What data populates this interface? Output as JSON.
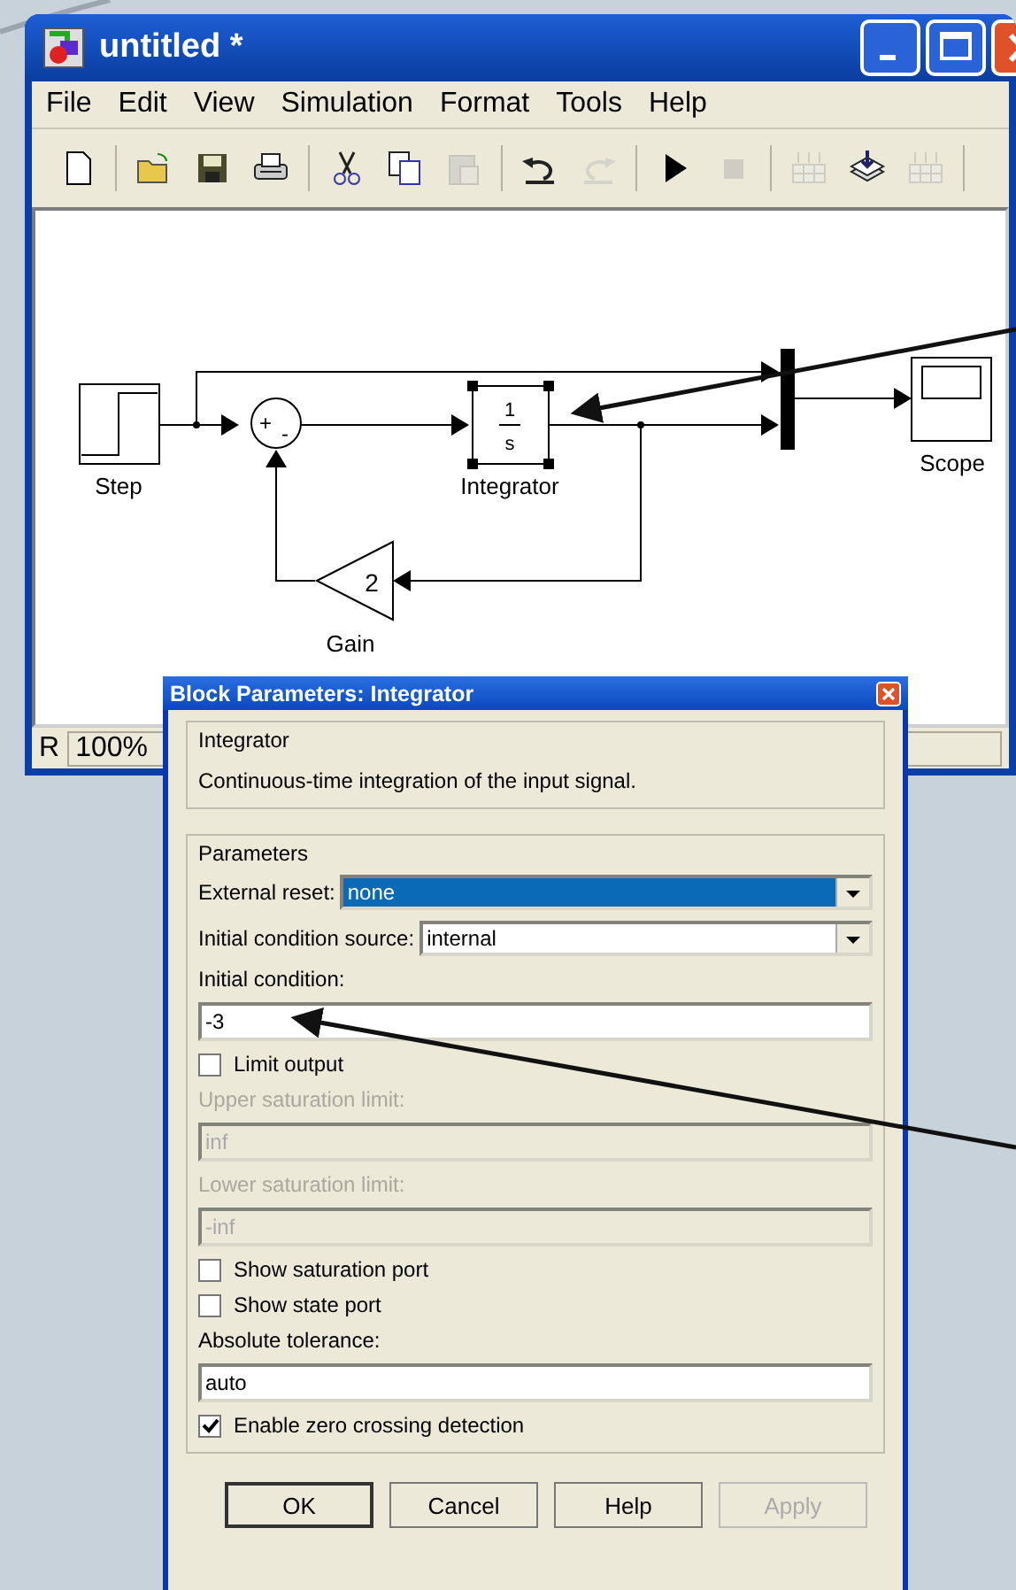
{
  "window": {
    "title": "untitled *",
    "controls": [
      {
        "kind": "minimize"
      },
      {
        "kind": "maximize"
      },
      {
        "kind": "close"
      }
    ]
  },
  "menu": [
    "File",
    "Edit",
    "View",
    "Simulation",
    "Format",
    "Tools",
    "Help"
  ],
  "toolbar": [
    {
      "kind": "new",
      "disabled": false
    },
    {
      "kind": "separator"
    },
    {
      "kind": "open",
      "disabled": false
    },
    {
      "kind": "save",
      "disabled": false
    },
    {
      "kind": "print",
      "disabled": false
    },
    {
      "kind": "separator"
    },
    {
      "kind": "cut",
      "disabled": false
    },
    {
      "kind": "copy",
      "disabled": false
    },
    {
      "kind": "paste",
      "disabled": true
    },
    {
      "kind": "separator"
    },
    {
      "kind": "undo",
      "disabled": false
    },
    {
      "kind": "redo",
      "disabled": true
    },
    {
      "kind": "separator"
    },
    {
      "kind": "start",
      "disabled": false
    },
    {
      "kind": "stop",
      "disabled": true
    },
    {
      "kind": "separator"
    },
    {
      "kind": "build",
      "disabled": true
    },
    {
      "kind": "update",
      "disabled": false
    },
    {
      "kind": "build",
      "disabled": true
    },
    {
      "kind": "separator"
    }
  ],
  "diagram": {
    "blocks": [
      {
        "kind": "step",
        "label": "Step",
        "selected": false
      },
      {
        "kind": "sum",
        "signs": [
          "+",
          "-"
        ],
        "selected": false
      },
      {
        "kind": "integrator",
        "label": "Integrator",
        "numerator": "1",
        "denominator": "s",
        "selected": true
      },
      {
        "kind": "gain",
        "label": "Gain",
        "value": "2",
        "selected": false
      },
      {
        "kind": "mux",
        "selected": false
      },
      {
        "kind": "scope",
        "label": "Scope",
        "selected": false
      }
    ]
  },
  "status_bar": {
    "mode": "R",
    "zoom": "100%"
  },
  "dialog": {
    "title": "Block Parameters: Integrator",
    "description": {
      "legend": "Integrator",
      "text": "Continuous-time integration of the input signal."
    },
    "parameters": {
      "legend": "Parameters",
      "items": [
        {
          "kind": "dropdown",
          "label": "External reset:",
          "value": "none",
          "selected": true
        },
        {
          "kind": "dropdown",
          "label": "Initial condition source:",
          "value": "internal",
          "selected": false
        },
        {
          "kind": "label",
          "text": "Initial condition:",
          "disabled": false
        },
        {
          "kind": "field",
          "value": "-3",
          "disabled": false
        },
        {
          "kind": "checkbox",
          "label": "Limit output",
          "checked": false
        },
        {
          "kind": "label",
          "text": "Upper saturation limit:",
          "disabled": true
        },
        {
          "kind": "field",
          "value": "inf",
          "disabled": true
        },
        {
          "kind": "label",
          "text": "Lower saturation limit:",
          "disabled": true
        },
        {
          "kind": "field",
          "value": "-inf",
          "disabled": true
        },
        {
          "kind": "checkbox",
          "label": "Show saturation port",
          "checked": false
        },
        {
          "kind": "checkbox",
          "label": "Show state port",
          "checked": false
        },
        {
          "kind": "label",
          "text": "Absolute tolerance:",
          "disabled": false
        },
        {
          "kind": "field",
          "value": "auto",
          "disabled": false
        },
        {
          "kind": "checkbox",
          "label": "Enable zero crossing detection",
          "checked": true
        }
      ]
    },
    "buttons": [
      {
        "label": "OK",
        "disabled": false
      },
      {
        "label": "Cancel",
        "disabled": false
      },
      {
        "label": "Help",
        "disabled": false
      },
      {
        "label": "Apply",
        "disabled": true
      }
    ]
  }
}
